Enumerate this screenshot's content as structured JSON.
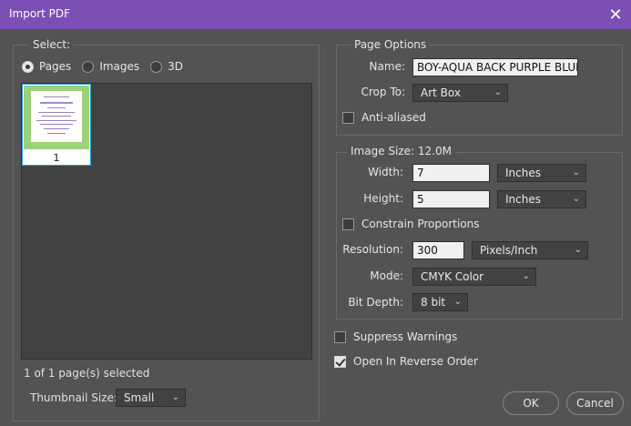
{
  "window": {
    "title": "Import PDF",
    "close_glyph": "✕"
  },
  "select_group": {
    "label": "Select:",
    "options": [
      {
        "label": "Pages",
        "checked": true
      },
      {
        "label": "Images",
        "checked": false
      },
      {
        "label": "3D",
        "checked": false
      }
    ],
    "thumbnail": {
      "page_number": "1"
    },
    "status": "1 of 1 page(s) selected",
    "thumbnail_size_label": "Thumbnail Size:",
    "thumbnail_size_value": "Small"
  },
  "page_options": {
    "label": "Page Options",
    "name_label": "Name:",
    "name_value": "BOY-AQUA BACK PURPLE BLUE",
    "crop_label": "Crop To:",
    "crop_value": "Art Box",
    "anti_aliased_label": "Anti-aliased"
  },
  "image_size": {
    "label": "Image Size: 12.0M",
    "width_label": "Width:",
    "width_value": "7",
    "width_unit": "Inches",
    "height_label": "Height:",
    "height_value": "5",
    "height_unit": "Inches",
    "constrain_label": "Constrain Proportions",
    "resolution_label": "Resolution:",
    "resolution_value": "300",
    "resolution_unit": "Pixels/Inch",
    "mode_label": "Mode:",
    "mode_value": "CMYK Color",
    "bitdepth_label": "Bit Depth:",
    "bitdepth_value": "8 bit"
  },
  "options": {
    "suppress_label": "Suppress Warnings",
    "reverse_label": "Open In Reverse Order"
  },
  "buttons": {
    "ok": "OK",
    "cancel": "Cancel"
  },
  "colors": {
    "titlebar": "#7b4fb3",
    "background": "#535353",
    "selection": "#2f9fd6"
  }
}
